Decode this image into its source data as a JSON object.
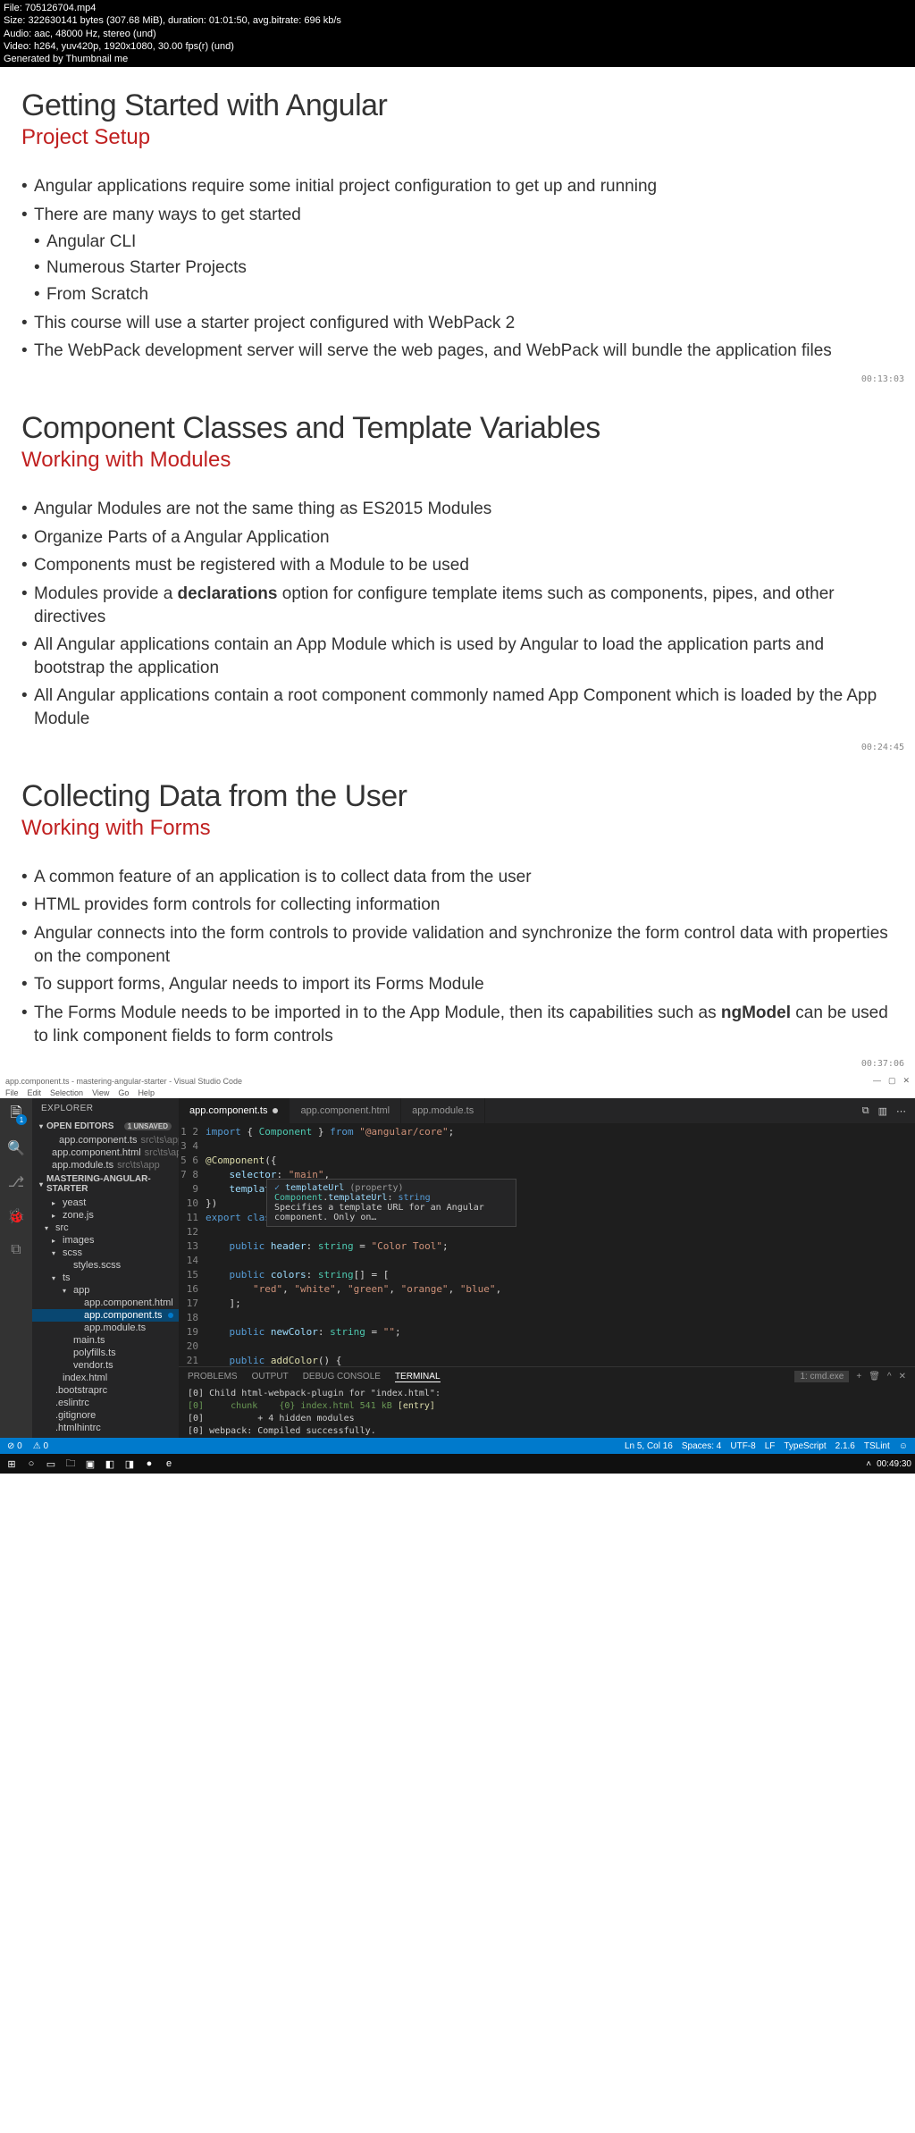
{
  "video_meta": {
    "line1": "File: 705126704.mp4",
    "line2": "Size: 322630141 bytes (307.68 MiB), duration: 01:01:50, avg.bitrate: 696 kb/s",
    "line3": "Audio: aac, 48000 Hz, stereo (und)",
    "line4": "Video: h264, yuv420p, 1920x1080, 30.00 fps(r) (und)",
    "line5": "Generated by Thumbnail me"
  },
  "slides": [
    {
      "title": "Getting Started with Angular",
      "subtitle": "Project Setup",
      "timestamp": "00:13:03",
      "bullets": [
        {
          "text": "Angular applications require some initial project configuration to get up and running"
        },
        {
          "text": "There are many ways to get started",
          "sub": [
            "Angular CLI",
            "Numerous Starter Projects",
            "From Scratch"
          ]
        },
        {
          "text": "This course will use a starter project configured with WebPack 2"
        },
        {
          "text": "The WebPack development server will serve the web pages, and WebPack will bundle the application files"
        }
      ]
    },
    {
      "title": "Component Classes and Template Variables",
      "subtitle": "Working with Modules",
      "timestamp": "00:24:45",
      "bullets": [
        {
          "text": "Angular Modules are not the same thing as ES2015 Modules"
        },
        {
          "text": "Organize Parts of a Angular Application"
        },
        {
          "text": "Components must be registered with a Module to be used"
        },
        {
          "html": "Modules provide a <span class=\"bold\">declarations</span> option for configure template items such as components, pipes, and other directives"
        },
        {
          "text": "All Angular applications contain an App Module which is used by Angular to load the application parts and bootstrap the application"
        },
        {
          "text": "All Angular applications contain a root component commonly named App Component which is loaded by the App Module"
        }
      ]
    },
    {
      "title": "Collecting Data from the User",
      "subtitle": "Working with Forms",
      "timestamp": "00:37:06",
      "bullets": [
        {
          "text": "A common feature of an application is to collect data from the user"
        },
        {
          "text": "HTML provides form controls for collecting information"
        },
        {
          "text": "Angular connects into the form controls to provide validation and synchronize the form control data with properties on the component"
        },
        {
          "text": "To support forms, Angular needs to import its Forms Module"
        },
        {
          "html": "The Forms Module needs to be imported in to the App Module, then its capabilities such as <span class=\"bold\">ngModel</span> can be used to link component fields to form controls"
        }
      ]
    }
  ],
  "vscode": {
    "title": "app.component.ts - mastering-angular-starter - Visual Studio Code",
    "menubar": [
      "File",
      "Edit",
      "Selection",
      "View",
      "Go",
      "Help"
    ],
    "sidebar": {
      "title": "EXPLORER",
      "open_editors": {
        "label": "OPEN EDITORS",
        "badge": "1 UNSAVED"
      },
      "open_files": [
        {
          "name": "app.component.ts",
          "path": "src\\ts\\app",
          "modified": true
        },
        {
          "name": "app.component.html",
          "path": "src\\ts\\app"
        },
        {
          "name": "app.module.ts",
          "path": "src\\ts\\app"
        }
      ],
      "project": "MASTERING-ANGULAR-STARTER",
      "tree": [
        {
          "label": "yeast",
          "indent": 1,
          "chev": "▸"
        },
        {
          "label": "zone.js",
          "indent": 1,
          "chev": "▸"
        },
        {
          "label": "src",
          "indent": 0,
          "chev": "▾"
        },
        {
          "label": "images",
          "indent": 1,
          "chev": "▸"
        },
        {
          "label": "scss",
          "indent": 1,
          "chev": "▾"
        },
        {
          "label": "styles.scss",
          "indent": 2
        },
        {
          "label": "ts",
          "indent": 1,
          "chev": "▾"
        },
        {
          "label": "app",
          "indent": 2,
          "chev": "▾"
        },
        {
          "label": "app.component.html",
          "indent": 3
        },
        {
          "label": "app.component.ts",
          "indent": 3,
          "selected": true,
          "dot": true
        },
        {
          "label": "app.module.ts",
          "indent": 3
        },
        {
          "label": "main.ts",
          "indent": 2
        },
        {
          "label": "polyfills.ts",
          "indent": 2
        },
        {
          "label": "vendor.ts",
          "indent": 2
        },
        {
          "label": "index.html",
          "indent": 1
        },
        {
          "label": ".bootstraprc",
          "indent": 0
        },
        {
          "label": ".eslintrc",
          "indent": 0
        },
        {
          "label": ".gitignore",
          "indent": 0
        },
        {
          "label": ".htmlhintrc",
          "indent": 0
        }
      ]
    },
    "tabs": [
      {
        "name": "app.component.ts",
        "active": true,
        "modified": true
      },
      {
        "name": "app.component.html"
      },
      {
        "name": "app.module.ts"
      }
    ],
    "code_lines": [
      "1",
      "2",
      "3",
      "4",
      "5",
      "6",
      "7",
      "8",
      "9",
      "10",
      "11",
      "12",
      "13",
      "14",
      "15",
      "16",
      "17",
      "18",
      "19",
      "20",
      "21"
    ],
    "tooltip": {
      "sig": "templateUrl  (property) Component.templateUrl: string",
      "desc": "Specifies a template URL for an Angular component. Only on…"
    },
    "panel": {
      "tabs": [
        "PROBLEMS",
        "OUTPUT",
        "DEBUG CONSOLE",
        "TERMINAL"
      ],
      "active": "TERMINAL",
      "select": "1: cmd.exe",
      "terminal_lines": [
        "[0] Child html-webpack-plugin for \"index.html\":",
        "[0]     chunk    {0} index.html 541 kB [entry]",
        "[0]          + 4 hidden modules",
        "[0] webpack: Compiled successfully."
      ]
    },
    "statusbar": {
      "left": [
        "⊘ 0",
        "⚠ 0"
      ],
      "right": [
        "Ln 5, Col 16",
        "Spaces: 4",
        "UTF-8",
        "LF",
        "TypeScript",
        "2.1.6",
        "TSLint",
        "☺"
      ]
    },
    "taskbar": {
      "time": "00:49:30"
    }
  }
}
